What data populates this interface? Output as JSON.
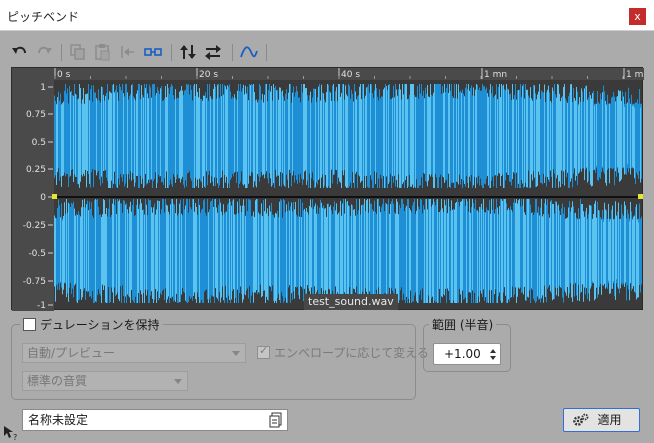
{
  "window": {
    "title": "ピッチベンド",
    "close_glyph": "x"
  },
  "toolbar": {
    "buttons": [
      {
        "icon": "undo-icon",
        "enabled": true
      },
      {
        "icon": "redo-icon",
        "enabled": false
      },
      {
        "icon": "copy-icon",
        "enabled": false
      },
      {
        "icon": "paste-icon",
        "enabled": false
      },
      {
        "icon": "go-to-start-icon",
        "enabled": false
      },
      {
        "icon": "link-icon",
        "enabled": true
      },
      {
        "icon": "flip-vertical-icon",
        "enabled": true
      },
      {
        "icon": "swap-icon",
        "enabled": true
      },
      {
        "icon": "curve-icon",
        "enabled": true
      }
    ]
  },
  "waveform": {
    "ruler_ticks": [
      "0 s",
      "20 s",
      "40 s",
      "1 mn",
      "1 m"
    ],
    "amplitude_labels": [
      "1",
      "0.75",
      "0.5",
      "0.25",
      "0",
      "-0.25",
      "-0.5",
      "-0.75",
      "-1"
    ],
    "file_label": "test_sound.wav",
    "colors": {
      "background": "#3a3a3a",
      "wave": "#1e8fd5",
      "wave_light": "#5bc3ef",
      "marker": "#e6e62e"
    }
  },
  "duration_group": {
    "legend": "デュレーションを保持",
    "checked": false,
    "mode_select": "自動/プレビュー",
    "quality_select": "標準の音質",
    "envelope_checkbox_label": "エンベロープに応じて変える",
    "envelope_checked": true
  },
  "range_group": {
    "legend": "範囲 (半音)",
    "value": "+1.00"
  },
  "preset": {
    "name": "名称未設定"
  },
  "apply_button": {
    "label": "適用"
  },
  "colors": {
    "accent": "#2f6fd6",
    "close": "#c42b2b",
    "dialog_bg": "#ababab"
  }
}
